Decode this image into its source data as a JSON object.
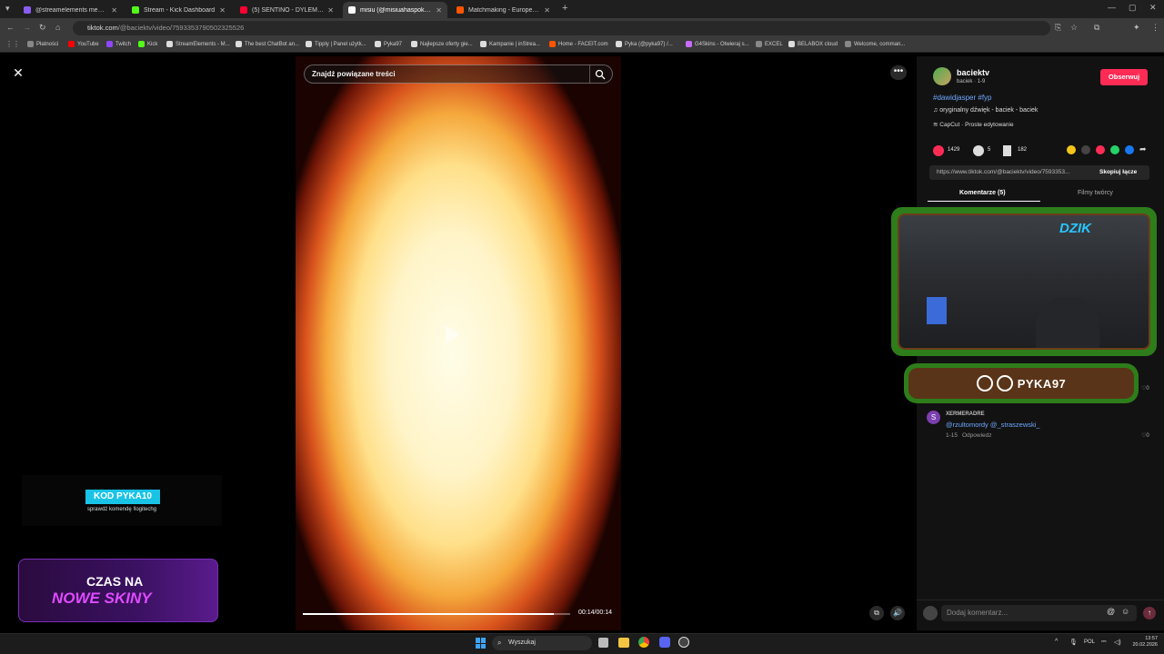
{
  "browser": {
    "tabs": [
      {
        "title": "@streamelements mentio...",
        "color": "#8a5cf6"
      },
      {
        "title": "Stream - Kick Dashboard",
        "color": "#53fc18"
      },
      {
        "title": "(5) SENTINO - DYLEMAT (prod...",
        "color": "#ff0033"
      },
      {
        "title": "misiu (@misiuahaspoko) | T...",
        "color": "#ffffff"
      },
      {
        "title": "Matchmaking - Europe 5v5 Q...",
        "color": "#ff5500"
      }
    ],
    "url_host": "tiktok.com",
    "url_path": "/@baciektv/video/7593353790502325526",
    "bookmarks": [
      "Płatności",
      "YouTube",
      "Twitch",
      "Kick",
      "StreamElements - M...",
      "The best ChatBot an...",
      "Tipply | Panel użytk...",
      "Pyka97",
      "Najlepsze oferty gie...",
      "Kampanie | inStrea...",
      "Home - FACEIT.com",
      "Pyka (@pyka97) /...",
      "G4Skins - Otwieraj s...",
      "EXCEL",
      "BELABOX cloud",
      "Welcome, comman..."
    ]
  },
  "video": {
    "search_placeholder": "Znajdź powiązane treści",
    "time": "00:14/00:14",
    "progress": 0.94
  },
  "creator": {
    "name": "baciektv",
    "sub": "baciek · 1-9",
    "follow": "Obserwuj",
    "hashtags": "#dawidjasper #fyp",
    "sound": "oryginalny dźwięk - baciek - baciek",
    "capcut": "CapCut · Proste edytowanie"
  },
  "stats": {
    "likes": "1429",
    "comments": "5",
    "saves": "182"
  },
  "link": {
    "url": "https://www.tiktok.com/@baciektv/video/7593353...",
    "copy": "Skopiuj łącze"
  },
  "panel_tabs": {
    "comments": "Komentarze (5)",
    "creator_videos": "Filmy twórcy"
  },
  "stream_overlay": {
    "logo": "DZIK",
    "social": "PYKA97"
  },
  "comment": {
    "author": "XERMERADRE",
    "text": "@rzultomordy @_straszewski_",
    "meta": "1-15",
    "reply": "Odpowiedz",
    "likes": "0",
    "prev_likes": "0"
  },
  "comment_input_placeholder": "Dodaj komentarz...",
  "promo": {
    "code": "KOD PYKA10",
    "sub": "sprawdź komendę !logitechg"
  },
  "skins": {
    "line1": "CZAS NA",
    "line2": "NOWE SKINY"
  },
  "taskbar": {
    "search": "Wyszukaj",
    "lang": "POL",
    "time": "13:57",
    "date": "20.02.2026"
  }
}
